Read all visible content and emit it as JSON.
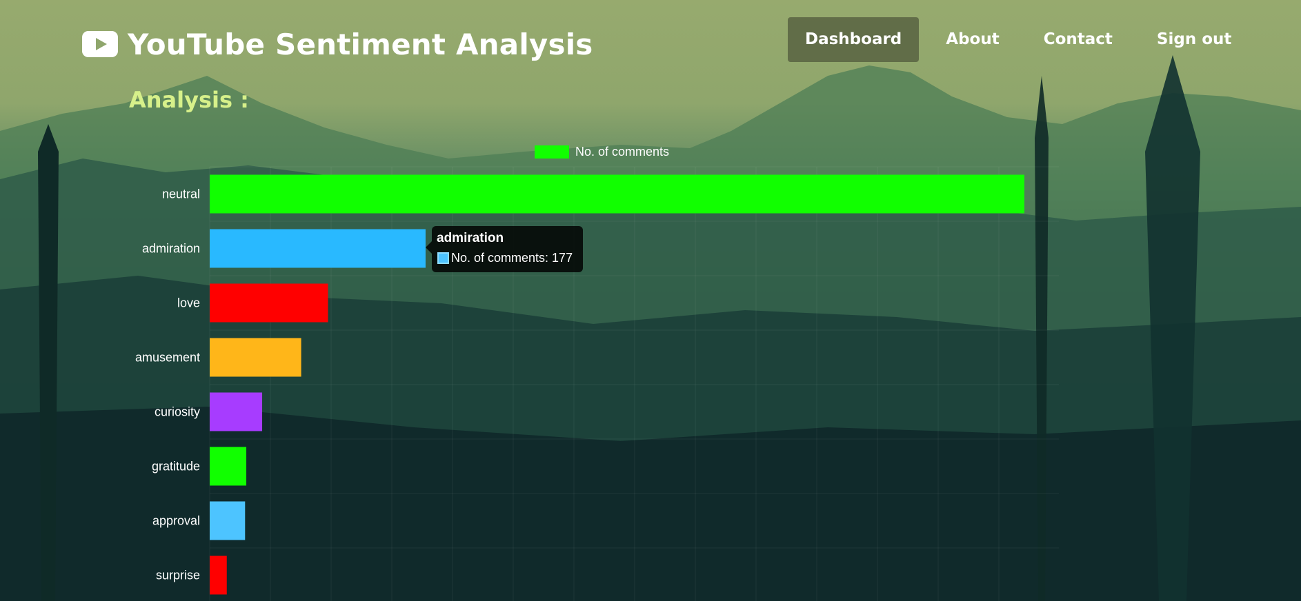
{
  "app": {
    "title": "YouTube Sentiment Analysis"
  },
  "nav": {
    "items": [
      {
        "label": "Dashboard",
        "active": true
      },
      {
        "label": "About",
        "active": false
      },
      {
        "label": "Contact",
        "active": false
      },
      {
        "label": "Sign out",
        "active": false
      }
    ]
  },
  "section": {
    "title": "Analysis :"
  },
  "colors": {
    "accent": "#d7f08a",
    "neutral": "#11ff00",
    "admiration": "#29b9ff",
    "love": "#ff0000",
    "amusement": "#ffb619",
    "curiosity": "#a73cff",
    "gratitude": "#11ff00",
    "approval": "#4dc4ff",
    "surprise": "#ff0000"
  },
  "icons": {
    "brand": "youtube-play-icon"
  },
  "tooltip": {
    "title": "admiration",
    "body": "No. of comments: 177"
  },
  "chart_data": {
    "type": "bar",
    "orientation": "horizontal",
    "title": "",
    "legend": {
      "position": "top",
      "entries": [
        "No. of comments"
      ]
    },
    "categories": [
      "neutral",
      "admiration",
      "love",
      "amusement",
      "curiosity",
      "gratitude",
      "approval",
      "surprise"
    ],
    "series": [
      {
        "name": "No. of comments",
        "values": [
          668,
          177,
          97,
          75,
          43,
          30,
          29,
          14
        ],
        "colors": [
          "#11ff00",
          "#29b9ff",
          "#ff0000",
          "#ffb619",
          "#a73cff",
          "#11ff00",
          "#4dc4ff",
          "#ff0000"
        ]
      }
    ],
    "xlim": [
      0,
      700
    ],
    "grid": true
  }
}
